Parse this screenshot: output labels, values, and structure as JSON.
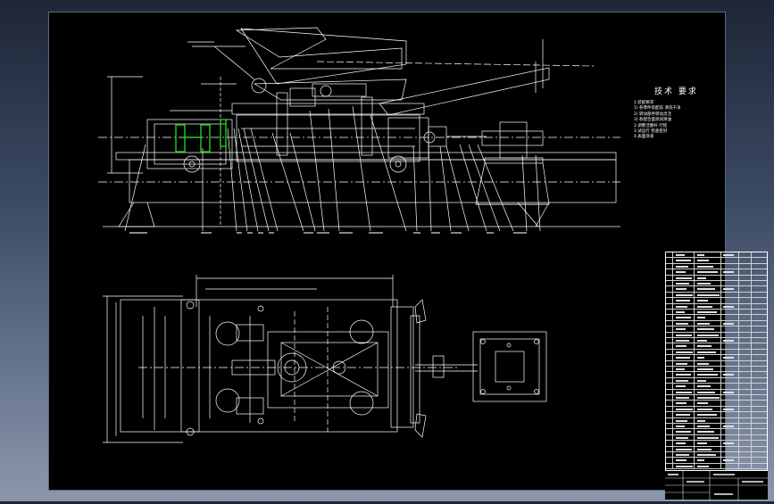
{
  "window": {
    "background_gradient": [
      "#1e2637",
      "#8a97ad"
    ],
    "sheet_color": "#000000",
    "line_color": "#ffffff",
    "highlight_color": "#1bd61b"
  },
  "technical_requirements": {
    "title": "技术 要求",
    "notes": [
      "1.装配要求",
      "1) 各零件装配前 清洗干净",
      "2) 转动部件转动灵活",
      "3) 各配合面涂润滑油",
      "2.调整活塞杆 行程",
      "3.试运行 检查密封",
      "4.表面涂漆"
    ]
  },
  "bom": {
    "row_count": 38
  }
}
